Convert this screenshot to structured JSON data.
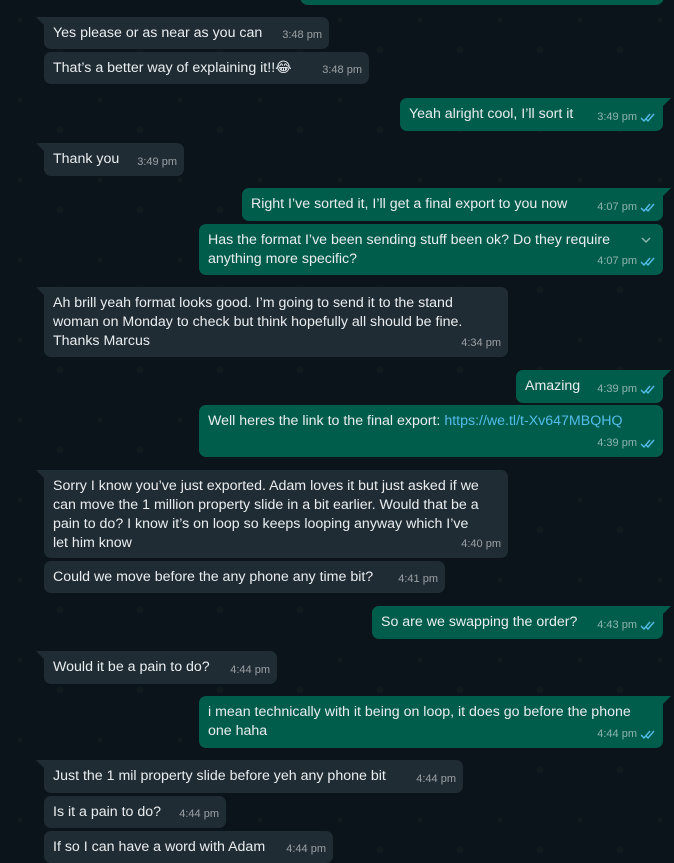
{
  "colors": {
    "incoming": "#202c33",
    "outgoing": "#005c4b",
    "background": "#0b141a",
    "text": "#e9edef",
    "link": "#53bdeb",
    "read_ticks": "#53bdeb"
  },
  "messages": [
    {
      "dir": "in",
      "text": "Yes please or as near as you can",
      "time": "3:48 pm"
    },
    {
      "dir": "in",
      "text": "That’s a better way of explaining it!!",
      "emoji": "😂",
      "time": "3:48 pm"
    },
    {
      "dir": "out",
      "text": "Yeah alright cool, I’ll sort it",
      "time": "3:49 pm",
      "status": "read"
    },
    {
      "dir": "in",
      "text": "Thank you",
      "time": "3:49 pm"
    },
    {
      "dir": "out",
      "text": "Right I’ve sorted it, I’ll get a final export to you now",
      "time": "4:07 pm",
      "status": "read"
    },
    {
      "dir": "out",
      "text": "Has the format I’ve been sending stuff been ok? Do they require\nanything more specific?",
      "time": "4:07 pm",
      "status": "read",
      "menu_icon": "chevron-down-icon"
    },
    {
      "dir": "in",
      "text": "Ah brill yeah format looks good. I’m going to send it to the stand\nwoman on Monday to check but think hopefully all should be fine.\nThanks Marcus",
      "time": "4:34 pm"
    },
    {
      "dir": "out",
      "text": "Amazing",
      "time": "4:39 pm",
      "status": "read"
    },
    {
      "dir": "out",
      "text": "Well heres the link to the final export: ",
      "link": "https://we.tl/t-Xv647MBQHQ",
      "time": "4:39 pm",
      "status": "read"
    },
    {
      "dir": "in",
      "text": "Sorry I know you’ve just exported. Adam loves it but just asked if we\ncan move the 1 million property slide in a bit earlier. Would that be a\npain to do? I know it’s on loop so keeps looping anyway which I’ve\nlet him know",
      "time": "4:40 pm"
    },
    {
      "dir": "in",
      "text": "Could we move before the any phone any time bit?",
      "time": "4:41 pm"
    },
    {
      "dir": "out",
      "text": "So are we swapping the order?",
      "time": "4:43 pm",
      "status": "read"
    },
    {
      "dir": "in",
      "text": "Would it be a pain to do?",
      "time": "4:44 pm"
    },
    {
      "dir": "out",
      "text": "i mean technically with it being on loop, it does go before the phone\none haha",
      "time": "4:44 pm",
      "status": "read"
    },
    {
      "dir": "in",
      "text": "Just the 1 mil property slide before yeh any phone bit",
      "time": "4:44 pm"
    },
    {
      "dir": "in",
      "text": "Is it a pain to do?",
      "time": "4:44 pm"
    },
    {
      "dir": "in",
      "text": "If so I can have a word with Adam",
      "time": "4:44 pm"
    }
  ]
}
